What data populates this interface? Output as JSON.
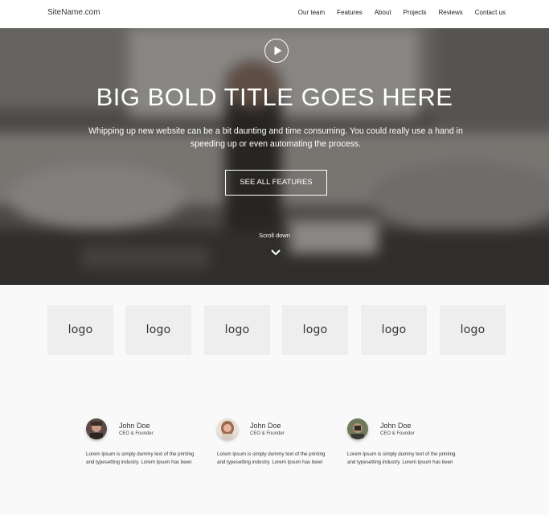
{
  "header": {
    "site_name": "SiteName.com",
    "nav": [
      {
        "label": "Our team"
      },
      {
        "label": "Features"
      },
      {
        "label": "About"
      },
      {
        "label": "Projects"
      },
      {
        "label": "Reviews"
      },
      {
        "label": "Contact us"
      }
    ]
  },
  "hero": {
    "play_icon": "play-icon",
    "title": "BIG BOLD TITLE GOES HERE",
    "subtitle": "Whipping up new website can be a bit daunting and time consuming. You could really use a hand in speeding up or even automating the process.",
    "button_label": "SEE ALL FEATURES",
    "scroll_label": "Scroll down",
    "scroll_icon": "chevron-down-icon"
  },
  "logos": [
    {
      "label": "logo"
    },
    {
      "label": "logo"
    },
    {
      "label": "logo"
    },
    {
      "label": "logo"
    },
    {
      "label": "logo"
    },
    {
      "label": "logo"
    }
  ],
  "team": [
    {
      "name": "John Doe",
      "role": "CEO & Founder",
      "bio": "Lorem Ipsum is simply dummy text of the printing and typesetting industry. Lorem Ipsum has been"
    },
    {
      "name": "John Doe",
      "role": "CEO & Founder",
      "bio": "Lorem Ipsum is simply dummy text of the printing and typesetting industry. Lorem Ipsum has been"
    },
    {
      "name": "John Doe",
      "role": "CEO & Founder",
      "bio": "Lorem Ipsum is simply dummy text of the printing and typesetting industry. Lorem Ipsum has been"
    }
  ],
  "colors": {
    "text": "#333333",
    "hero_overlay": "#1e1e1e",
    "logo_box": "#eeeeee",
    "section_bg": "#f9f9f9"
  }
}
